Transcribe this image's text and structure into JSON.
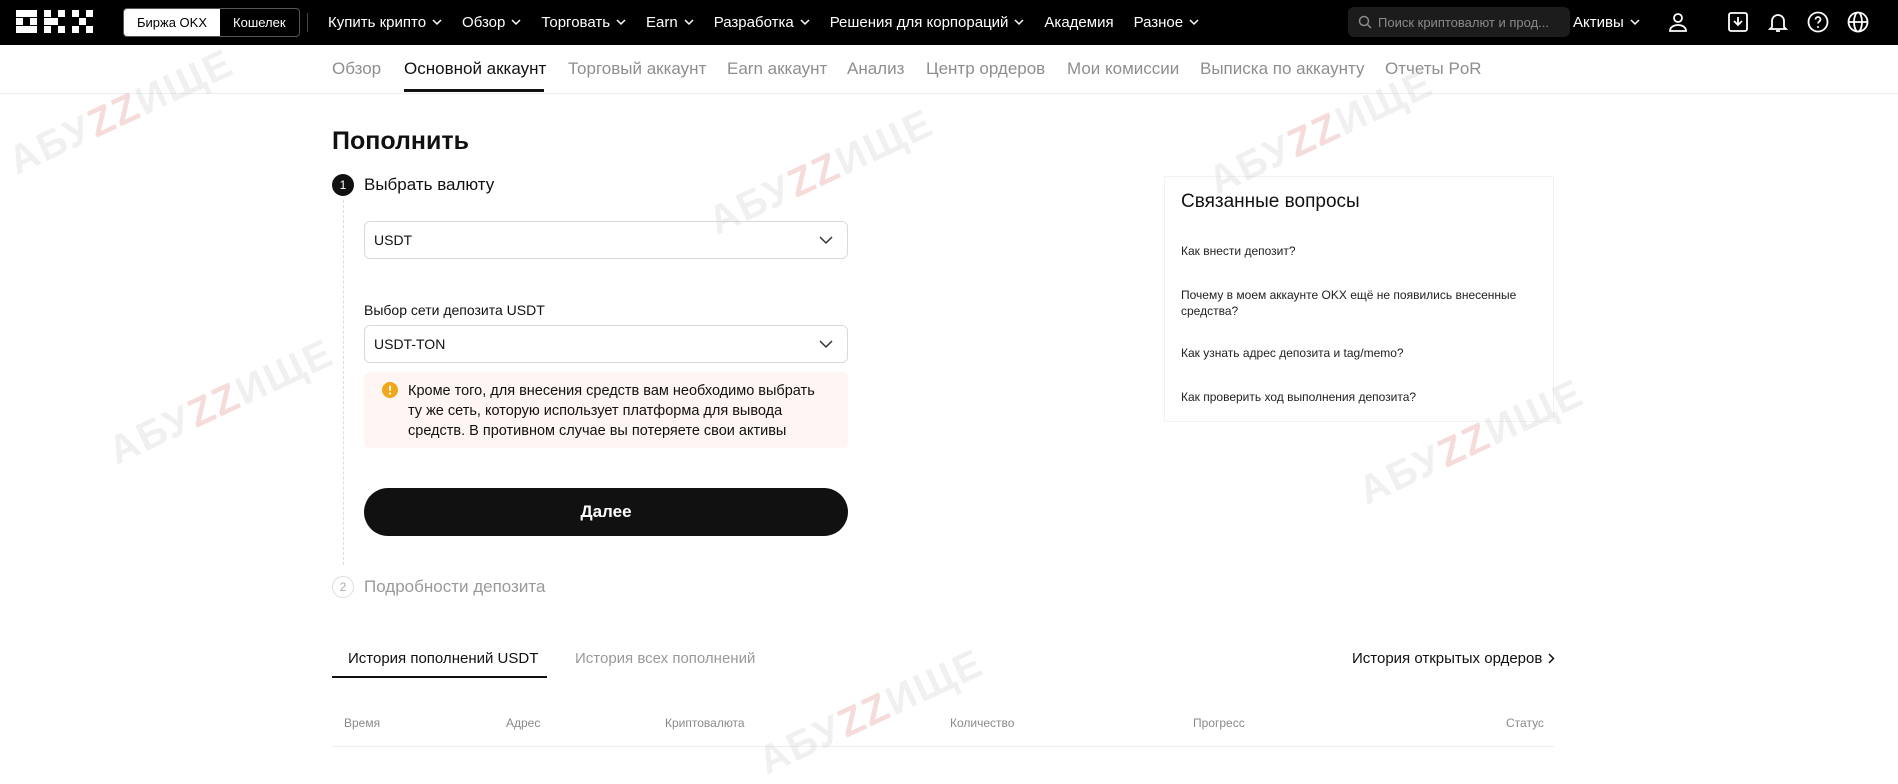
{
  "topbar": {
    "logo": "OKX",
    "switch": [
      "Биржа OKX",
      "Кошелек"
    ],
    "nav": [
      {
        "label": "Купить крипто",
        "dropdown": true
      },
      {
        "label": "Обзор",
        "dropdown": true
      },
      {
        "label": "Торговать",
        "dropdown": true
      },
      {
        "label": "Earn",
        "dropdown": true
      },
      {
        "label": "Разработка",
        "dropdown": true
      },
      {
        "label": "Решения для корпораций",
        "dropdown": true
      },
      {
        "label": "Академия",
        "dropdown": false
      },
      {
        "label": "Разное",
        "dropdown": true
      }
    ],
    "search_placeholder": "Поиск криптовалют и прод...",
    "assets_label": "Активы",
    "icons": [
      "user-icon",
      "download-icon",
      "bell-icon",
      "help-icon",
      "globe-icon"
    ]
  },
  "subnav": {
    "tabs": [
      "Обзор",
      "Основной аккаунт",
      "Торговый аккаунт",
      "Earn аккаунт",
      "Анализ",
      "Центр ордеров",
      "Мои комиссии",
      "Выписка по аккаунту",
      "Отчеты PoR"
    ],
    "active": "Основной аккаунт"
  },
  "deposit": {
    "title": "Пополнить",
    "step1": {
      "num": "1",
      "label": "Выбрать валюту"
    },
    "currency_value": "USDT",
    "network_label": "Выбор сети депозита USDT",
    "network_value": "USDT-TON",
    "warning": "Кроме того, для внесения средств вам необходимо выбрать ту же сеть, которую использует платформа для вывода средств. В противном случае вы потеряете свои активы",
    "next_button": "Далее",
    "step2": {
      "num": "2",
      "label": "Подробности депозита"
    }
  },
  "faq": {
    "title": "Связанные вопросы",
    "items": [
      "Как внести депозит?",
      "Почему в моем аккаунте OKX ещё не появились внесенные средства?",
      "Как узнать адрес депозита и tag/memo?",
      "Как проверить ход выполнения депозита?"
    ]
  },
  "history": {
    "tabs": [
      "История пополнений USDT",
      "История всех пополнений"
    ],
    "open_orders_link": "История открытых ордеров",
    "columns": [
      "Время",
      "Адрес",
      "Криптовалюта",
      "Количество",
      "Прогресс",
      "Статус"
    ]
  },
  "watermark": {
    "text_a": "АБУ",
    "text_b": "ZZ",
    "text_c": "ИЩЕ"
  },
  "colors": {
    "topbar": "#000000",
    "accent": "#111111",
    "warning_bg": "#fff5f2",
    "warning_icon": "#f0a81a"
  }
}
